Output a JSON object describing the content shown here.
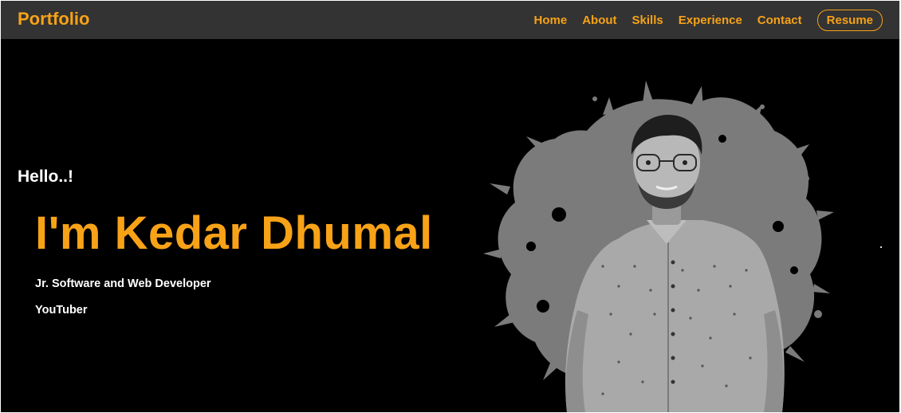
{
  "nav": {
    "brand": "Portfolio",
    "links": [
      "Home",
      "About",
      "Skills",
      "Experience",
      "Contact"
    ],
    "resume": "Resume"
  },
  "hero": {
    "greeting": "Hello..!",
    "name": "I'm Kedar Dhumal",
    "roles": [
      "Jr. Software and Web Developer",
      "YouTuber"
    ],
    "photo_icon": "person-photo"
  },
  "colors": {
    "accent": "#f7a217",
    "navbar": "#333333",
    "background": "#000000",
    "text": "#ffffff"
  }
}
